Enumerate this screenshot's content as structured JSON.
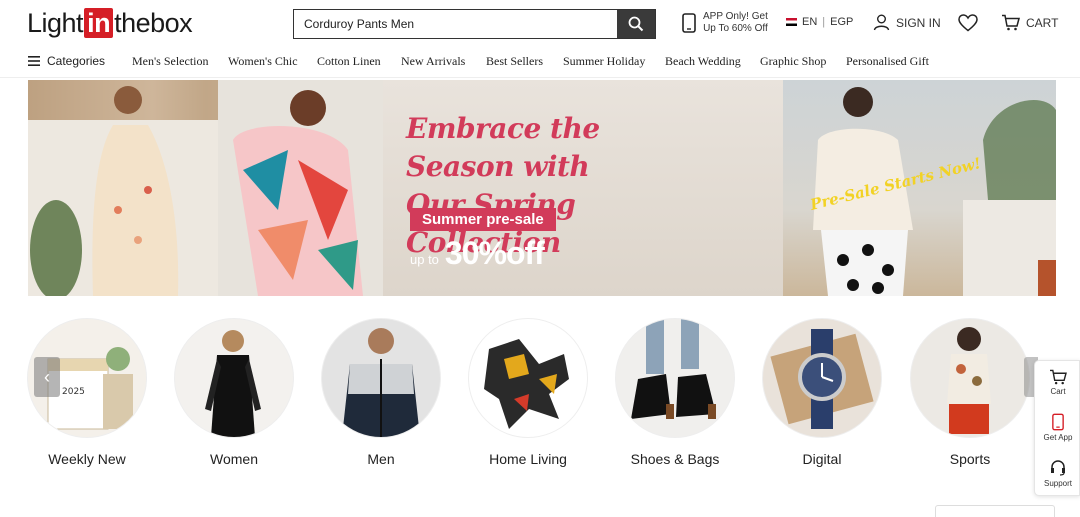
{
  "header": {
    "logo": {
      "pre": "Light",
      "in": "in",
      "post": "thebox"
    },
    "search": {
      "value": "Corduroy Pants Men",
      "placeholder": "Search"
    },
    "app_promo": {
      "line1": "APP Only! Get",
      "line2": "Up To 60% Off"
    },
    "language": "EN",
    "currency": "EGP",
    "sign_in": "SIGN IN",
    "cart": "CART"
  },
  "nav": {
    "categories": "Categories",
    "items": [
      "Men's Selection",
      "Women's Chic",
      "Cotton Linen",
      "New Arrivals",
      "Best Sellers",
      "Summer Holiday",
      "Beach Wedding",
      "Graphic Shop",
      "Personalised Gift"
    ]
  },
  "banner": {
    "headline_line1": "Embrace the Season with",
    "headline_line2": "Our Spring Collection",
    "tag": "Summer pre-sale",
    "upto": "up to",
    "discount": "30%off",
    "starts": "Pre-Sale Starts Now!"
  },
  "categories": [
    {
      "label": "Weekly New",
      "icon": "calendar-icon"
    },
    {
      "label": "Women",
      "icon": "dress-icon"
    },
    {
      "label": "Men",
      "icon": "jacket-icon"
    },
    {
      "label": "Home Living",
      "icon": "toy-icon"
    },
    {
      "label": "Shoes & Bags",
      "icon": "shoe-icon"
    },
    {
      "label": "Digital",
      "icon": "watch-icon"
    },
    {
      "label": "Sports",
      "icon": "sports-icon"
    }
  ],
  "side_panel": {
    "cart": "Cart",
    "app": "Get App",
    "support": "Support"
  },
  "colors": {
    "brand_red": "#d51e26",
    "banner_pink": "#d23b5a",
    "banner_yellow": "#f2d225"
  }
}
